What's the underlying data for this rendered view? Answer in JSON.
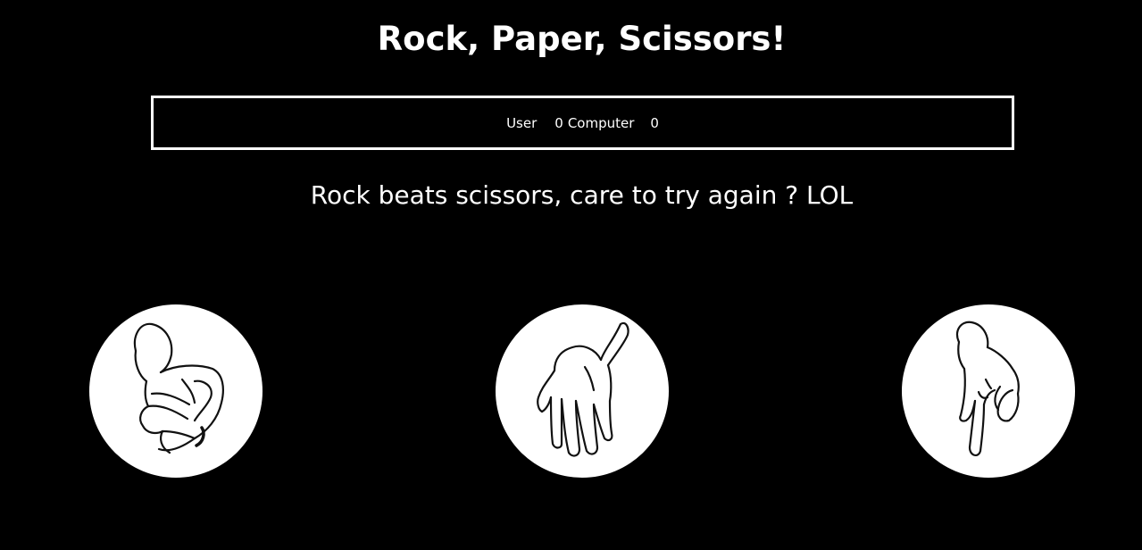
{
  "header": {
    "title": "Rock, Paper, Scissors!"
  },
  "scoreboard": {
    "user_label": "User",
    "user_score": "0",
    "computer_label": "Computer",
    "computer_score": "0"
  },
  "result": {
    "message": "Rock beats scissors, care to try again ? LOL"
  },
  "choices": [
    {
      "id": "rock",
      "icon": "rock-hand-icon"
    },
    {
      "id": "paper",
      "icon": "paper-hand-icon"
    },
    {
      "id": "scissors",
      "icon": "scissors-hand-icon"
    }
  ],
  "colors": {
    "background": "#000000",
    "foreground": "#ffffff"
  }
}
